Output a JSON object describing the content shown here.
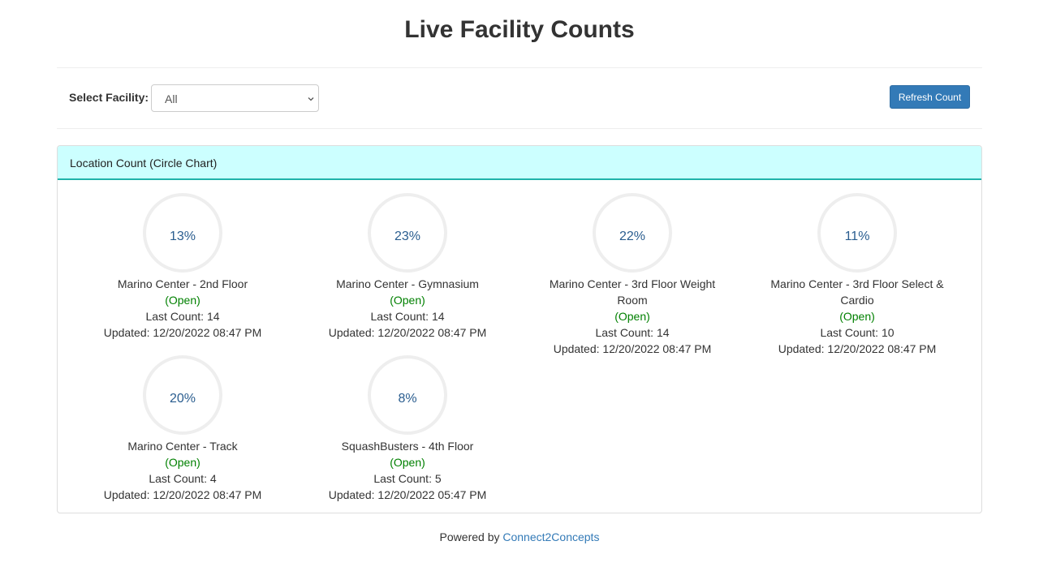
{
  "page": {
    "title": "Live Facility Counts"
  },
  "toolbar": {
    "select_label": "Select Facility:",
    "select_value": "All",
    "refresh_label": "Refresh Count"
  },
  "panel": {
    "heading": "Location Count (Circle Chart)"
  },
  "locations": [
    {
      "percent": "13%",
      "name": "Marino Center - 2nd Floor",
      "status": "(Open)",
      "last_count": "Last Count: 14",
      "updated": "Updated: 12/20/2022 08:47 PM"
    },
    {
      "percent": "23%",
      "name": "Marino Center - Gymnasium",
      "status": "(Open)",
      "last_count": "Last Count: 14",
      "updated": "Updated: 12/20/2022 08:47 PM"
    },
    {
      "percent": "22%",
      "name": "Marino Center - 3rd Floor Weight Room",
      "status": "(Open)",
      "last_count": "Last Count: 14",
      "updated": "Updated: 12/20/2022 08:47 PM"
    },
    {
      "percent": "11%",
      "name": "Marino Center - 3rd Floor Select & Cardio",
      "status": "(Open)",
      "last_count": "Last Count: 10",
      "updated": "Updated: 12/20/2022 08:47 PM"
    },
    {
      "percent": "20%",
      "name": "Marino Center - Track",
      "status": "(Open)",
      "last_count": "Last Count: 4",
      "updated": "Updated: 12/20/2022 08:47 PM"
    },
    {
      "percent": "8%",
      "name": "SquashBusters - 4th Floor",
      "status": "(Open)",
      "last_count": "Last Count: 5",
      "updated": "Updated: 12/20/2022 05:47 PM"
    }
  ],
  "footer": {
    "prefix": "Powered by",
    "link": "Connect2Concepts"
  },
  "colors": {
    "accent": "#337ab7",
    "open": "#008000",
    "panel_heading_bg": "#ccffff",
    "panel_border": "#20b2aa",
    "ring_track": "#eeeeee",
    "percent_text": "#2a5d8f"
  },
  "icons": {
    "select_caret": "chevron-down-icon"
  }
}
